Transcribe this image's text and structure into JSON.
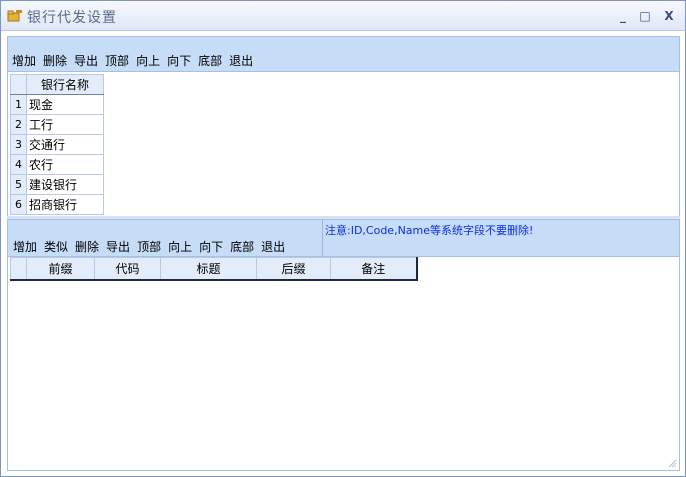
{
  "window": {
    "title": "银行代发设置",
    "controls": {
      "minimize": "_",
      "maximize": "□",
      "close": "X"
    }
  },
  "toolbar_top": {
    "items": [
      "增加",
      "删除",
      "导出",
      "顶部",
      "向上",
      "向下",
      "底部",
      "退出"
    ]
  },
  "bank_grid": {
    "header": "银行名称",
    "rows": [
      {
        "num": "1",
        "name": "现金"
      },
      {
        "num": "2",
        "name": "工行"
      },
      {
        "num": "3",
        "name": "交通行"
      },
      {
        "num": "4",
        "name": "农行"
      },
      {
        "num": "5",
        "name": "建设银行"
      },
      {
        "num": "6",
        "name": "招商银行"
      }
    ]
  },
  "toolbar_bottom": {
    "items": [
      "增加",
      "类似",
      "删除",
      "导出",
      "顶部",
      "向上",
      "向下",
      "底部",
      "退出"
    ],
    "notice": "注意:ID,Code,Name等系统字段不要删除!"
  },
  "field_grid": {
    "columns": [
      "前缀",
      "代码",
      "标题",
      "后缀",
      "备注"
    ]
  },
  "icons": {
    "app": "folder-key-icon",
    "grip": "resize-grip-icon"
  },
  "colors": {
    "toolbar_bg": "#c6dcf7",
    "notice_text": "#0a2fd6",
    "title_text": "#5a6c8e"
  }
}
